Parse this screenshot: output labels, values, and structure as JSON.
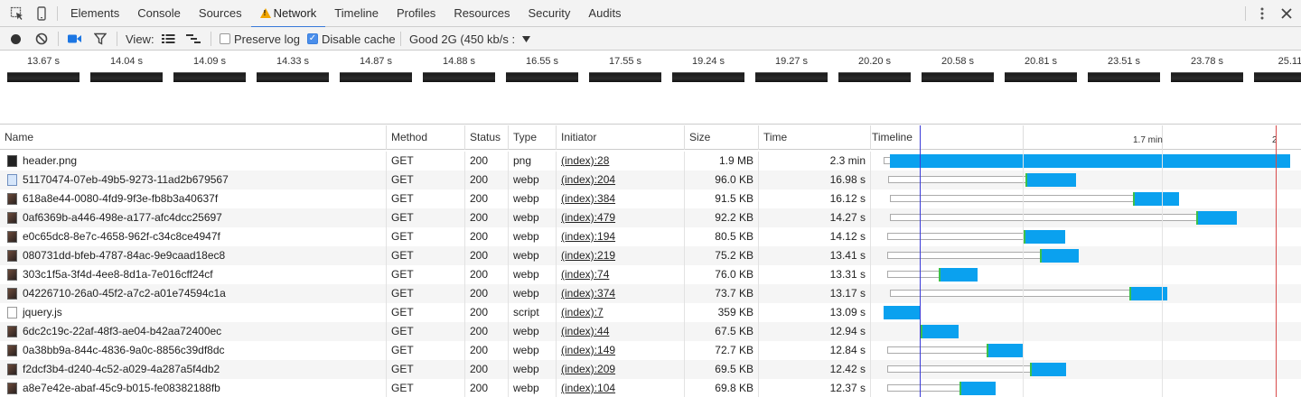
{
  "tabs": [
    "Elements",
    "Console",
    "Sources",
    "Network",
    "Timeline",
    "Profiles",
    "Resources",
    "Security",
    "Audits"
  ],
  "selected_tab": "Network",
  "toolbar": {
    "view_label": "View:",
    "preserve_log_label": "Preserve log",
    "preserve_log_checked": false,
    "disable_cache_label": "Disable cache",
    "disable_cache_checked": true,
    "throttle_value": "Good 2G (450 kb/s :"
  },
  "filmstrip": [
    "13.67 s",
    "14.04 s",
    "14.09 s",
    "14.33 s",
    "14.87 s",
    "14.88 s",
    "16.55 s",
    "17.55 s",
    "19.24 s",
    "19.27 s",
    "20.20 s",
    "20.58 s",
    "20.81 s",
    "23.51 s",
    "23.78 s",
    "25.11"
  ],
  "columns": {
    "name": "Name",
    "method": "Method",
    "status": "Status",
    "type": "Type",
    "initiator": "Initiator",
    "size": "Size",
    "time": "Time",
    "timeline": "Timeline"
  },
  "timeline_ticks": [
    "1.7 min",
    "2"
  ],
  "requests": [
    {
      "name": "header.png",
      "method": "GET",
      "status": "200",
      "type": "png",
      "initiator": "(index):28",
      "size": "1.9 MB",
      "time": "2.3 min"
    },
    {
      "name": "51170474-07eb-49b5-9273-11ad2b679567",
      "method": "GET",
      "status": "200",
      "type": "webp",
      "initiator": "(index):204",
      "size": "96.0 KB",
      "time": "16.98 s"
    },
    {
      "name": "618a8e44-0080-4fd9-9f3e-fb8b3a40637f",
      "method": "GET",
      "status": "200",
      "type": "webp",
      "initiator": "(index):384",
      "size": "91.5 KB",
      "time": "16.12 s"
    },
    {
      "name": "0af6369b-a446-498e-a177-afc4dcc25697",
      "method": "GET",
      "status": "200",
      "type": "webp",
      "initiator": "(index):479",
      "size": "92.2 KB",
      "time": "14.27 s"
    },
    {
      "name": "e0c65dc8-8e7c-4658-962f-c34c8ce4947f",
      "method": "GET",
      "status": "200",
      "type": "webp",
      "initiator": "(index):194",
      "size": "80.5 KB",
      "time": "14.12 s"
    },
    {
      "name": "080731dd-bfeb-4787-84ac-9e9caad18ec8",
      "method": "GET",
      "status": "200",
      "type": "webp",
      "initiator": "(index):219",
      "size": "75.2 KB",
      "time": "13.41 s"
    },
    {
      "name": "303c1f5a-3f4d-4ee8-8d1a-7e016cff24cf",
      "method": "GET",
      "status": "200",
      "type": "webp",
      "initiator": "(index):74",
      "size": "76.0 KB",
      "time": "13.31 s"
    },
    {
      "name": "04226710-26a0-45f2-a7c2-a01e74594c1a",
      "method": "GET",
      "status": "200",
      "type": "webp",
      "initiator": "(index):374",
      "size": "73.7 KB",
      "time": "13.17 s"
    },
    {
      "name": "jquery.js",
      "method": "GET",
      "status": "200",
      "type": "script",
      "initiator": "(index):7",
      "size": "359 KB",
      "time": "13.09 s"
    },
    {
      "name": "6dc2c19c-22af-48f3-ae04-b42aa72400ec",
      "method": "GET",
      "status": "200",
      "type": "webp",
      "initiator": "(index):44",
      "size": "67.5 KB",
      "time": "12.94 s"
    },
    {
      "name": "0a38bb9a-844c-4836-9a0c-8856c39df8dc",
      "method": "GET",
      "status": "200",
      "type": "webp",
      "initiator": "(index):149",
      "size": "72.7 KB",
      "time": "12.84 s"
    },
    {
      "name": "f2dcf3b4-d240-4c52-a029-4a287a5f4db2",
      "method": "GET",
      "status": "200",
      "type": "webp",
      "initiator": "(index):209",
      "size": "69.5 KB",
      "time": "12.42 s"
    },
    {
      "name": "a8e7e42e-abaf-45c9-b015-fe08382188fb",
      "method": "GET",
      "status": "200",
      "type": "webp",
      "initiator": "(index):104",
      "size": "69.8 KB",
      "time": "12.37 s"
    }
  ],
  "colors": {
    "receiving_bar": "#0aa1ef",
    "waiting_marker": "#3cc04b",
    "dom_content_loaded_line": "#3b3bd8",
    "load_line": "#d84b4b",
    "selected_tab_underline": "#3879d9"
  }
}
